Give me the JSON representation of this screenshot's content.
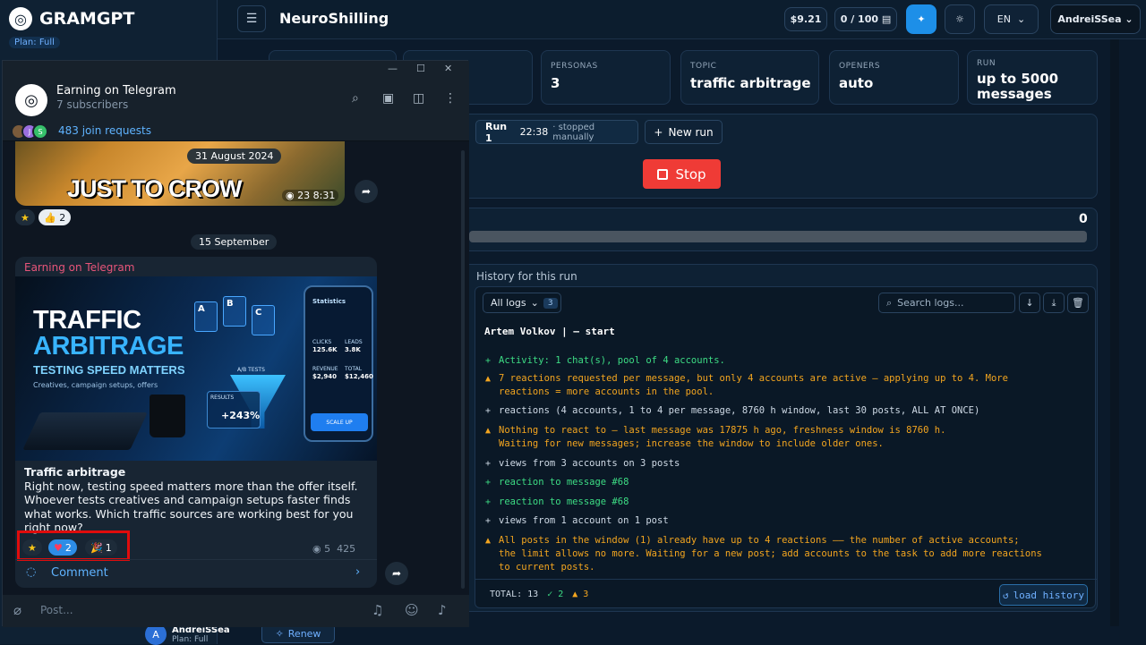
{
  "sidebar": {
    "brand": "GRAMGPT",
    "plan": "Plan: Full",
    "user": {
      "initial": "A",
      "name": "AndreiSSea",
      "plan": "Plan: Full"
    },
    "renew": "Renew"
  },
  "topbar": {
    "title": "NeuroShilling",
    "balance": "$9.21",
    "quota": "0 / 100",
    "lang": "EN",
    "user": "AndreiSSea"
  },
  "stats": [
    {
      "label": "PERSONAS",
      "value": "3"
    },
    {
      "label": "TOPIC",
      "value": "traffic arbitrage"
    },
    {
      "label": "OPENERS",
      "value": "auto"
    },
    {
      "label": "RUN",
      "value": "up to 5000 messages"
    }
  ],
  "run": {
    "label": "Run 1",
    "time": "22:38",
    "status": "· stopped manually",
    "new_run": "New run",
    "stop": "Stop"
  },
  "progress": {
    "value": "0"
  },
  "history": {
    "title": "History for this run",
    "filter": "All logs",
    "filter_count": "3",
    "search_placeholder": "Search logs...",
    "start": "Artem Volkov | — start",
    "lines": [
      {
        "type": "ok",
        "icon": "+",
        "text": "Activity: 1 chat(s), pool of 4 accounts."
      },
      {
        "type": "warn",
        "icon": "▲",
        "text": "7 reactions requested per message, but only 4 accounts are active — applying up to 4. More"
      },
      {
        "type": "warn",
        "icon": "",
        "text": "reactions = more accounts in the pool."
      },
      {
        "type": "info",
        "icon": "+",
        "text": "reactions (4 accounts, 1 to 4 per message, 8760 h window, last 30 posts, ALL AT ONCE)"
      },
      {
        "type": "warn",
        "icon": "▲",
        "text": "Nothing to react to — last message was 17875 h ago, freshness window is 8760 h."
      },
      {
        "type": "warn",
        "icon": "",
        "text": "Waiting for new messages; increase the window to include older ones."
      },
      {
        "type": "info",
        "icon": "+",
        "text": "views from 3 accounts on 3 posts"
      },
      {
        "type": "ok",
        "icon": "+",
        "text": "reaction to message #68"
      },
      {
        "type": "ok",
        "icon": "+",
        "text": "reaction to message #68"
      },
      {
        "type": "info",
        "icon": "+",
        "text": "views from 1 account on 1 post"
      },
      {
        "type": "warn",
        "icon": "▲",
        "text": "All posts in the window (1) already have up to 4 reactions —— the number of active accounts;"
      },
      {
        "type": "warn",
        "icon": "",
        "text": "the limit allows no more. Waiting for a new post; add accounts to the task to add more reactions"
      },
      {
        "type": "warn",
        "icon": "",
        "text": "to current posts."
      }
    ],
    "total_label": "TOTAL: 13",
    "ok_count": "✓ 2",
    "warn_count": "▲ 3",
    "load": "load history"
  },
  "telegram": {
    "channel": "Earning on Telegram",
    "subs": "7 subscribers",
    "join": "483 join requests",
    "join_av": [
      "",
      "J",
      "S"
    ],
    "post1": {
      "banner": "JUST TO CROW",
      "date": "31 August 2024",
      "views": "23",
      "time": "8:31",
      "react_star": "★",
      "react_like": "👍 2"
    },
    "date2": "15 September",
    "post2": {
      "channel": "Earning on Telegram",
      "img": {
        "l1": "TRAFFIC",
        "l2": "ARBITRAGE",
        "l3": "TESTING SPEED MATTERS",
        "l4": "Creatives, campaign setups, offers",
        "stats": "Statistics",
        "clicks": "CLICKS",
        "clicks_v": "125.6K",
        "leads": "LEADS",
        "leads_v": "3.8K",
        "revenue": "REVENUE",
        "revenue_v": "$2,940",
        "total": "TOTAL",
        "total_v": "$12,460",
        "scale": "SCALE UP",
        "ab": "A/B TESTS",
        "results": "RESULTS",
        "pct": "+243%",
        "tiles": [
          "A",
          "B",
          "C"
        ]
      },
      "title": "Traffic arbitrage",
      "body": "Right now, testing speed matters more than the offer itself. Whoever tests creatives and campaign setups faster finds what works. Which traffic sources are working best for you right now?",
      "r_star": "★",
      "r_heart": "2",
      "r_party": "1",
      "views": "5",
      "time": "425",
      "comment": "Comment"
    },
    "composer": "Post..."
  }
}
